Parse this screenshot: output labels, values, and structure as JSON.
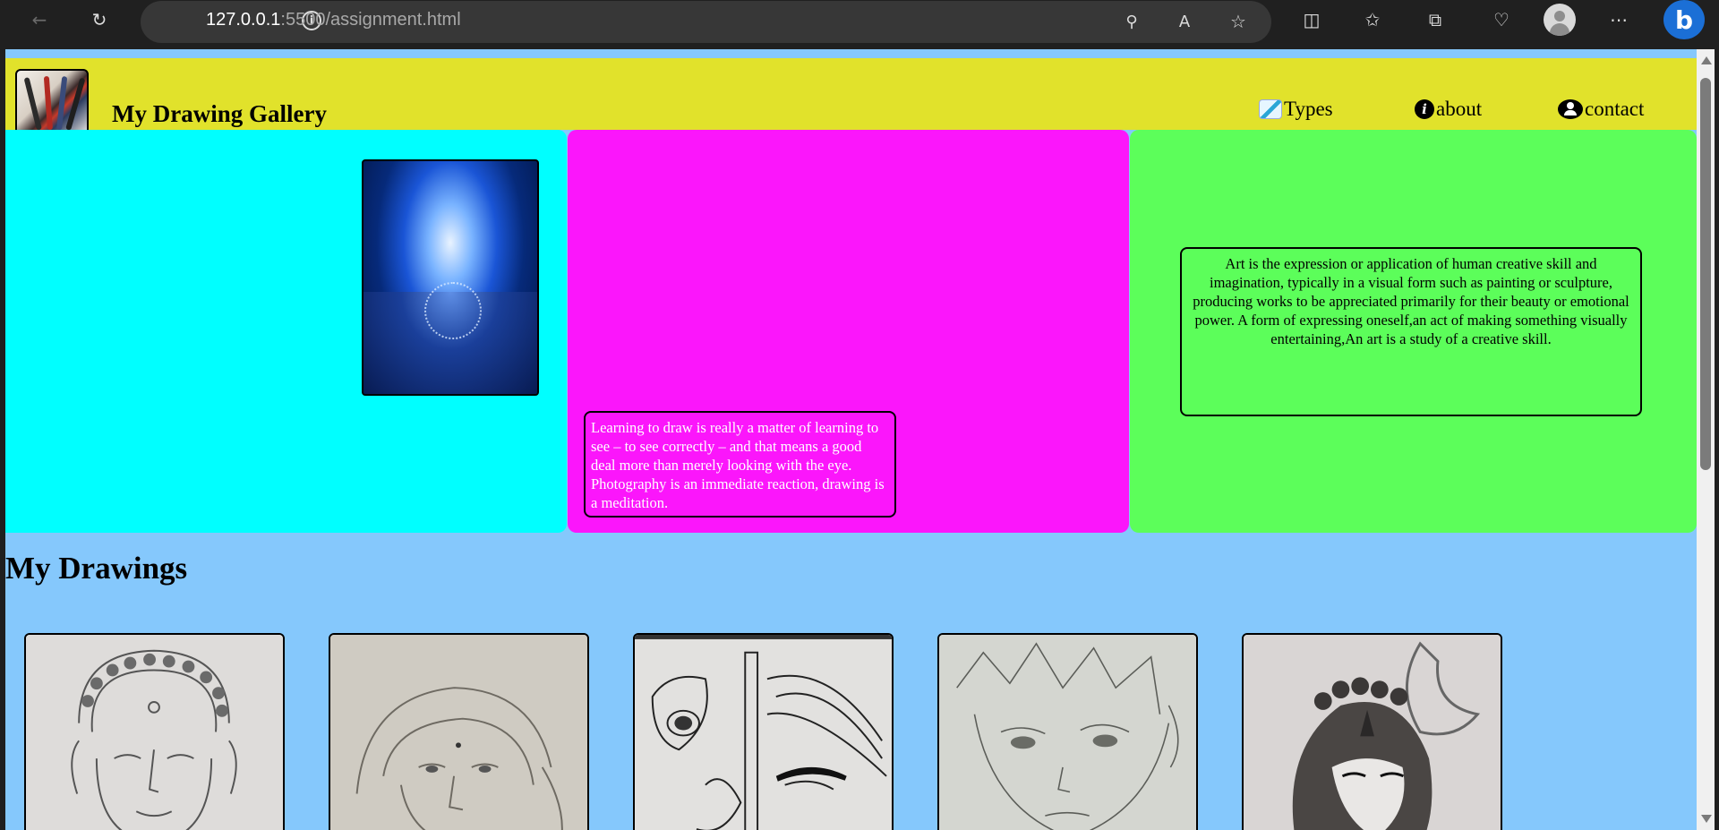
{
  "browser": {
    "url_host": "127.0.0.1",
    "url_path": ":5500/assignment.html"
  },
  "header": {
    "title": "My Drawing Gallery",
    "nav": [
      {
        "label": "Types",
        "icon": "pencil-icon"
      },
      {
        "label": "about",
        "icon": "info-icon"
      },
      {
        "label": "contact",
        "icon": "user-icon"
      }
    ]
  },
  "panels": {
    "quote": "Learning to draw is really a matter of learning to see – to see correctly – and that means a good deal more than merely looking with the eye. Photography is an immediate reaction, drawing is a meditation.",
    "definition": "Art is the expression or application of human creative skill and imagination, typically in a visual form such as painting or sculpture, producing works to be appreciated primarily for their beauty or emotional power. A form of expressing oneself,an act of making something visually entertaining,An art is a study of a creative skill."
  },
  "drawings": {
    "title": "My Drawings",
    "items": [
      "buddha-sketch",
      "girl-portrait-sketch",
      "krishna-flute-sketch",
      "anime-boy-sketch",
      "shiva-sketch"
    ]
  },
  "colors": {
    "page_bg": "#85c8fc",
    "header_bg": "#e1e22b",
    "panel_cyan": "#00ffff",
    "panel_pink": "#fb16fb",
    "panel_green": "#5cfe5a"
  }
}
